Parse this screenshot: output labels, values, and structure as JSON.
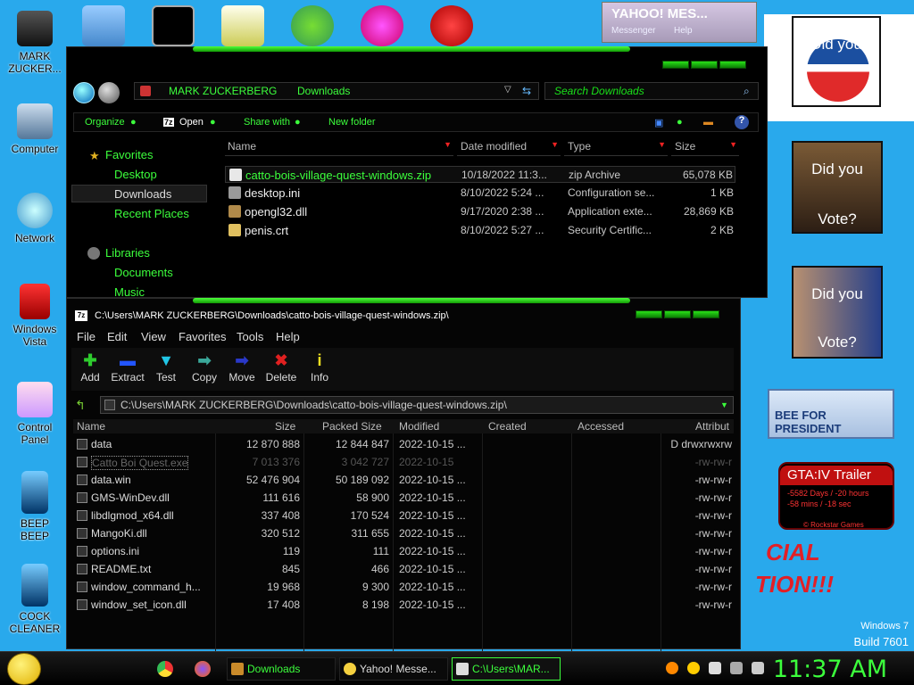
{
  "desktop_icons": [
    {
      "label": "MARK\nZUCKER..."
    },
    {
      "label": "Computer"
    },
    {
      "label": "Network"
    },
    {
      "label": "Windows\nVista"
    },
    {
      "label": "Control\nPanel"
    },
    {
      "label": "BEEP\nBEEP"
    },
    {
      "label": "COCK\nCLEANER"
    }
  ],
  "yahoo_widget": {
    "logo": "YAHOO! MES...",
    "menu1": "Messenger",
    "menu2": "Help"
  },
  "wallpaper": {
    "poster1": "Did you",
    "poster2_top": "Did you",
    "poster2_bottom": "Vote?",
    "poster3_top": "Did you",
    "poster3_bottom": "Vote?",
    "huckabee": "BEE FOR PRESIDENT",
    "gta_title": "GTA:IV Trailer",
    "gta_line1": "-5582 Days / -20 hours",
    "gta_line2": "-58 mins / -18 sec",
    "gta_brand": "© Rockstar Games",
    "slogan1": "CIAL",
    "slogan2": "TION!!!",
    "win_name": "Windows 7",
    "win_build": "Build 7601"
  },
  "explorer": {
    "breadcrumb1": "MARK ZUCKERBERG",
    "breadcrumb2": "Downloads",
    "search_placeholder": "Search Downloads",
    "toolbar": {
      "organize": "Organize",
      "open": "Open",
      "share": "Share with",
      "new_folder": "New folder"
    },
    "nav": {
      "favorites": "Favorites",
      "desktop": "Desktop",
      "downloads": "Downloads",
      "recent": "Recent Places",
      "libraries": "Libraries",
      "documents": "Documents",
      "music": "Music"
    },
    "columns": {
      "name": "Name",
      "date": "Date modified",
      "type": "Type",
      "size": "Size"
    },
    "files": [
      {
        "name": "catto-bois-village-quest-windows.zip",
        "date": "10/18/2022 11:3...",
        "type": "zip Archive",
        "size": "65,078 KB",
        "color": "#e8e8e8"
      },
      {
        "name": "desktop.ini",
        "date": "8/10/2022 5:24 ...",
        "type": "Configuration se...",
        "size": "1 KB",
        "color": "#9a9a9a"
      },
      {
        "name": "opengl32.dll",
        "date": "9/17/2020 2:38 ...",
        "type": "Application exte...",
        "size": "28,869 KB",
        "color": "#b08a4a"
      },
      {
        "name": "penis.crt",
        "date": "8/10/2022 5:27 ...",
        "type": "Security Certific...",
        "size": "2 KB",
        "color": "#e0c060"
      }
    ]
  },
  "zip": {
    "title": "C:\\Users\\MARK ZUCKERBERG\\Downloads\\catto-bois-village-quest-windows.zip\\",
    "menu": [
      "File",
      "Edit",
      "View",
      "Favorites",
      "Tools",
      "Help"
    ],
    "tools": [
      {
        "label": "Add",
        "glyph": "✚",
        "color": "#2ecc2e"
      },
      {
        "label": "Extract",
        "glyph": "▬",
        "color": "#2255ff"
      },
      {
        "label": "Test",
        "glyph": "▼",
        "color": "#21c6e6"
      },
      {
        "label": "Copy",
        "glyph": "➡",
        "color": "#3aa89a"
      },
      {
        "label": "Move",
        "glyph": "➡",
        "color": "#2a38c9"
      },
      {
        "label": "Delete",
        "glyph": "✖",
        "color": "#e02020"
      },
      {
        "label": "Info",
        "glyph": "i",
        "color": "#f0e020"
      }
    ],
    "path": "C:\\Users\\MARK ZUCKERBERG\\Downloads\\catto-bois-village-quest-windows.zip\\",
    "columns": {
      "name": "Name",
      "size": "Size",
      "packed": "Packed Size",
      "modified": "Modified",
      "created": "Created",
      "accessed": "Accessed",
      "attrib": "Attribut"
    },
    "rows": [
      {
        "name": "data",
        "size": "12 870 888",
        "packed": "12 844 847",
        "modified": "2022-10-15 ...",
        "attrib": "D drwxrwxrw",
        "faded": false
      },
      {
        "name": "Catto Boi Quest.exe",
        "size": "7 013 376",
        "packed": "3 042 727",
        "modified": "2022-10-15",
        "attrib": "-rw-rw-r",
        "faded": true
      },
      {
        "name": "data.win",
        "size": "52 476 904",
        "packed": "50 189 092",
        "modified": "2022-10-15 ...",
        "attrib": "-rw-rw-r",
        "faded": false
      },
      {
        "name": "GMS-WinDev.dll",
        "size": "111 616",
        "packed": "58 900",
        "modified": "2022-10-15 ...",
        "attrib": "-rw-rw-r",
        "faded": false
      },
      {
        "name": "libdlgmod_x64.dll",
        "size": "337 408",
        "packed": "170 524",
        "modified": "2022-10-15 ...",
        "attrib": "-rw-rw-r",
        "faded": false
      },
      {
        "name": "MangoKi.dll",
        "size": "320 512",
        "packed": "311 655",
        "modified": "2022-10-15 ...",
        "attrib": "-rw-rw-r",
        "faded": false
      },
      {
        "name": "options.ini",
        "size": "119",
        "packed": "111",
        "modified": "2022-10-15 ...",
        "attrib": "-rw-rw-r",
        "faded": false
      },
      {
        "name": "README.txt",
        "size": "845",
        "packed": "466",
        "modified": "2022-10-15 ...",
        "attrib": "-rw-rw-r",
        "faded": false
      },
      {
        "name": "window_command_h...",
        "size": "19 968",
        "packed": "9 300",
        "modified": "2022-10-15 ...",
        "attrib": "-rw-rw-r",
        "faded": false
      },
      {
        "name": "window_set_icon.dll",
        "size": "17 408",
        "packed": "8 198",
        "modified": "2022-10-15 ...",
        "attrib": "-rw-rw-r",
        "faded": false
      }
    ]
  },
  "taskbar": {
    "buttons": [
      {
        "label": "Downloads",
        "icon_color": "#c98a2a"
      },
      {
        "label": "Yahoo! Messe...",
        "icon_color": "#f4d03f"
      },
      {
        "label": "C:\\Users\\MAR...",
        "icon_color": "#dddddd"
      }
    ],
    "clock": "11:37 AM"
  }
}
